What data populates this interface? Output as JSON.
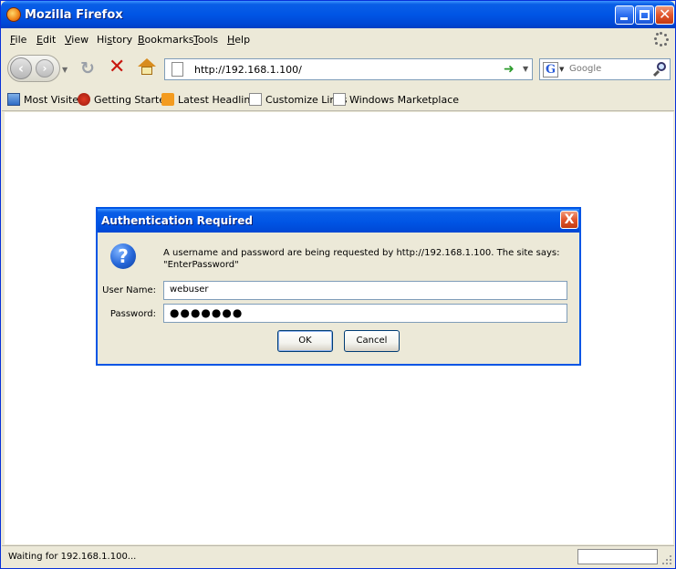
{
  "window": {
    "title": "Mozilla Firefox"
  },
  "menu": {
    "items": [
      {
        "underline": "F",
        "rest": "ile"
      },
      {
        "underline": "E",
        "rest": "dit"
      },
      {
        "underline": "V",
        "rest": "iew"
      },
      {
        "pre": "Hi",
        "underline": "s",
        "rest": "tory"
      },
      {
        "underline": "B",
        "rest": "ookmarks"
      },
      {
        "underline": "T",
        "rest": "ools"
      },
      {
        "underline": "H",
        "rest": "elp"
      }
    ]
  },
  "navbar": {
    "url": "http://192.168.1.100/",
    "search_placeholder": "Google",
    "search_engine_letter": "G"
  },
  "bookmarks": [
    {
      "label": "Most Visited",
      "icon": "most-visited-icon"
    },
    {
      "label": "Getting Started",
      "icon": "firefox-icon"
    },
    {
      "label": "Latest Headlines",
      "icon": "rss-icon"
    },
    {
      "label": "Customize Links",
      "icon": "page-icon"
    },
    {
      "label": "Windows Marketplace",
      "icon": "page-icon"
    }
  ],
  "dialog": {
    "title": "Authentication Required",
    "close_glyph": "X",
    "icon_glyph": "?",
    "message_line1": "A username and password are being requested by http://192.168.1.100. The site says:",
    "message_line2": "\"EnterPassword\"",
    "username_label": "User Name:",
    "username_value": "webuser",
    "password_label": "Password:",
    "password_value": "●●●●●●●",
    "ok_label": "OK",
    "cancel_label": "Cancel"
  },
  "status": {
    "text": "Waiting for 192.168.1.100..."
  }
}
